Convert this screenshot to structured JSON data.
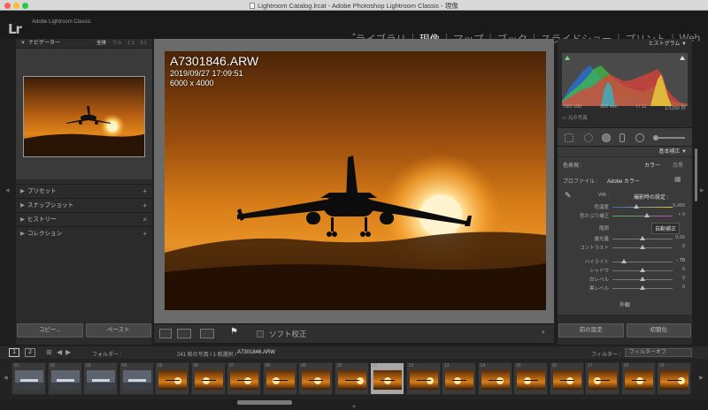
{
  "window": {
    "title": "Lightroom Catalog.lrcat - Adobe Photoshop Lightroom Classic - 現像"
  },
  "identity": {
    "logo": "Lr",
    "app_name": "Adobe Lightroom Classic"
  },
  "modules": [
    {
      "label": "ライブラリ",
      "active": false
    },
    {
      "label": "現像",
      "active": true
    },
    {
      "label": "マップ",
      "active": false
    },
    {
      "label": "ブック",
      "active": false
    },
    {
      "label": "スライドショー",
      "active": false
    },
    {
      "label": "プリント",
      "active": false
    },
    {
      "label": "Web",
      "active": false
    }
  ],
  "left": {
    "navigator": {
      "title": "ナビゲーター",
      "zoom_options": [
        "全体",
        "フル",
        "1:1",
        "3:1"
      ]
    },
    "sections": [
      {
        "label": "プリセット",
        "action": "+"
      },
      {
        "label": "スナップショット",
        "action": "+"
      },
      {
        "label": "ヒストリー",
        "action": "×"
      },
      {
        "label": "コレクション",
        "action": "+"
      }
    ],
    "copy_label": "コピー...",
    "paste_label": "ペースト"
  },
  "photo": {
    "filename": "A7301846.ARW",
    "datetime": "2019/09/27 17:09:51",
    "dimensions": "6000 x 4000"
  },
  "toolbar": {
    "soft_proof_label": "ソフト校正"
  },
  "right": {
    "histogram_title": "ヒストグラム",
    "exif": {
      "iso": "ISO 100",
      "focal": "350 mm",
      "aperture": "f / 11",
      "shutter": "1/1250 秒"
    },
    "original_photo": "元の写真",
    "basic_title": "基本補正",
    "treatment_label": "色表現 :",
    "treatment_color": "カラー",
    "treatment_bw": "白黒",
    "profile_label": "プロファイル :",
    "profile_value": "Adobe カラー",
    "wb_label": "WB :",
    "wb_value": "撮影時の設定 :",
    "temp_label": "色温度",
    "temp_value": "5,450",
    "tint_label": "色かぶり補正",
    "tint_value": "+ 9",
    "tone_label": "階調",
    "auto_label": "自動補正",
    "exposure_label": "露光量",
    "exposure_value": "0.00",
    "contrast_label": "コントラスト",
    "contrast_value": "0",
    "highlights_label": "ハイライト",
    "highlights_value": "- 70",
    "shadows_label": "シャドウ",
    "shadows_value": "0",
    "whites_label": "白レベル",
    "whites_value": "0",
    "blacks_label": "黒レベル",
    "blacks_value": "0",
    "presence_label": "外観",
    "prev_label": "前の設定",
    "reset_label": "初期化"
  },
  "filmbar": {
    "page1": "1",
    "page2": "2",
    "folder_label": "フォルダー :",
    "count_text": "241 枚の写真 / 1 枚選択 /",
    "selected_file": "A7301846.ARW",
    "filter_label": "フィルター :",
    "filter_value": "フィルターオフ"
  },
  "filmstrip": [
    {
      "num": "01"
    },
    {
      "num": "02"
    },
    {
      "num": "03"
    },
    {
      "num": "04"
    },
    {
      "num": "05"
    },
    {
      "num": "06"
    },
    {
      "num": "07"
    },
    {
      "num": "08"
    },
    {
      "num": "09"
    },
    {
      "num": "10"
    },
    {
      "num": "01",
      "selected": true
    },
    {
      "num": "12"
    },
    {
      "num": "13"
    },
    {
      "num": "14"
    },
    {
      "num": "15"
    },
    {
      "num": "16"
    },
    {
      "num": "17"
    },
    {
      "num": "18"
    },
    {
      "num": "19"
    }
  ]
}
